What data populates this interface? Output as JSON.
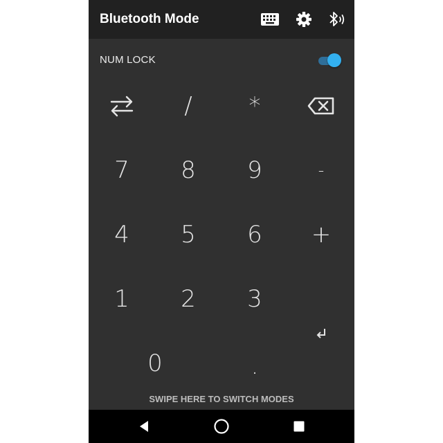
{
  "app_bar": {
    "title": "Bluetooth Mode",
    "icons": [
      "keyboard-icon",
      "settings-gear-icon",
      "bluetooth-audio-icon"
    ]
  },
  "num_lock": {
    "label": "NUM LOCK",
    "enabled": true,
    "accent_color": "#33b0f0"
  },
  "keypad": {
    "row1": [
      "swap-arrows-icon",
      "/",
      "*",
      "backspace-icon"
    ],
    "row2": [
      "7",
      "8",
      "9",
      "-"
    ],
    "row3": [
      "4",
      "5",
      "6",
      "+"
    ],
    "row4": [
      "1",
      "2",
      "3"
    ],
    "row5": [
      "0",
      ".",
      "enter-icon"
    ]
  },
  "keys": {
    "slash": "/",
    "asterisk": "*",
    "seven": "7",
    "eight": "8",
    "nine": "9",
    "minus": "-",
    "four": "4",
    "five": "5",
    "six": "6",
    "plus": "+",
    "one": "1",
    "two": "2",
    "three": "3",
    "zero": "0",
    "decimal": "."
  },
  "footer": {
    "swipe_text": "SWIPE HERE TO SWITCH MODES"
  },
  "nav_bar": {
    "buttons": [
      "back-icon",
      "home-icon",
      "recents-icon"
    ]
  }
}
